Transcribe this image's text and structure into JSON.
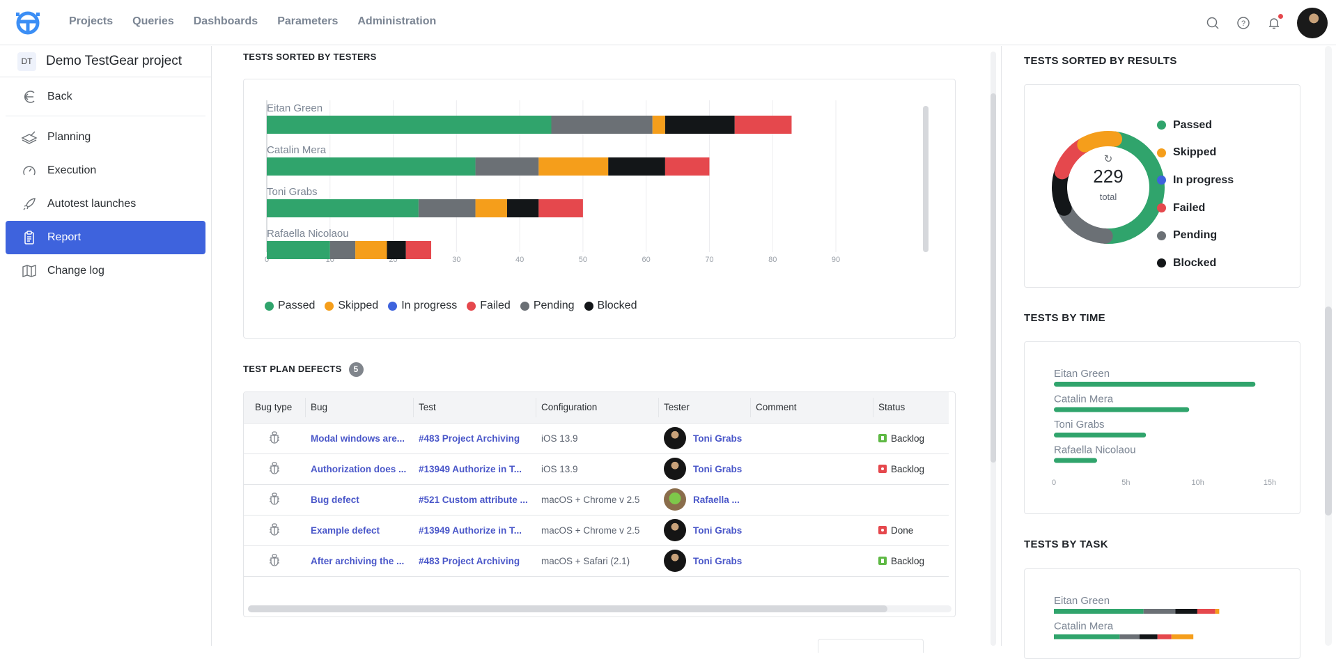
{
  "topbar": {
    "nav": [
      "Projects",
      "Queries",
      "Dashboards",
      "Parameters",
      "Administration"
    ],
    "icons": [
      "search-icon",
      "help-icon",
      "bell-icon",
      "user-avatar"
    ],
    "has_notification": true
  },
  "sidebar": {
    "project_badge": "DT",
    "project_name": "Demo TestGear project",
    "back_label": "Back",
    "items": [
      {
        "label": "Planning",
        "icon": "planning-icon"
      },
      {
        "label": "Execution",
        "icon": "speedometer-icon"
      },
      {
        "label": "Autotest launches",
        "icon": "rocket-icon"
      },
      {
        "label": "Report",
        "icon": "clipboard-icon",
        "active": true
      },
      {
        "label": "Change log",
        "icon": "map-icon"
      }
    ]
  },
  "colors": {
    "Passed": "#30a46c",
    "Skipped": "#f59e1b",
    "In progress": "#3e63dd",
    "Failed": "#e5484d",
    "Pending": "#6b7075",
    "Blocked": "#131618"
  },
  "testers_section": {
    "title": "TESTS SORTED BY TESTERS"
  },
  "defects_section": {
    "title": "TEST PLAN DEFECTS",
    "count": "5",
    "columns": [
      "Bug type",
      "Bug",
      "Test",
      "Configuration",
      "Tester",
      "Comment",
      "Status"
    ],
    "rows": [
      {
        "bug": "Modal windows are...",
        "test": "#483 Project Archiving",
        "configuration": "iOS 13.9",
        "tester": "Toni Grabs",
        "avatar": "dark",
        "comment": "",
        "status": "Backlog",
        "status_color": "green"
      },
      {
        "bug": "Authorization does ...",
        "test": "#13949 Authorize in T...",
        "configuration": "iOS 13.9",
        "tester": "Toni Grabs",
        "avatar": "dark",
        "comment": "",
        "status": "Backlog",
        "status_color": "red"
      },
      {
        "bug": "Bug defect",
        "test": "#521 Custom attribute ...",
        "configuration": "macOS + Chrome v 2.5",
        "tester": "Rafaella ...",
        "avatar": "green",
        "comment": "",
        "status": "",
        "status_color": ""
      },
      {
        "bug": "Example defect",
        "test": "#13949 Authorize in T...",
        "configuration": "macOS + Chrome v 2.5",
        "tester": "Toni Grabs",
        "avatar": "dark",
        "comment": "",
        "status": "Done",
        "status_color": "red"
      },
      {
        "bug": "After archiving the ...",
        "test": "#483 Project Archiving",
        "configuration": "macOS + Safari (2.1)",
        "tester": "Toni Grabs",
        "avatar": "dark",
        "comment": "",
        "status": "Backlog",
        "status_color": "green"
      }
    ]
  },
  "results_section": {
    "title": "TESTS SORTED BY RESULTS",
    "total": "229",
    "total_label": "total"
  },
  "time_section": {
    "title": "TESTS BY TIME"
  },
  "task_section": {
    "title": "TESTS BY TASK"
  },
  "chart_data": [
    {
      "type": "bar",
      "orientation": "horizontal-stacked",
      "title": "TESTS SORTED BY TESTERS",
      "categories": [
        "Eitan Green",
        "Catalin Mera",
        "Toni Grabs",
        "Rafaella Nicolaou"
      ],
      "series": [
        {
          "name": "Passed",
          "values": [
            45,
            33,
            24,
            10
          ]
        },
        {
          "name": "Pending",
          "values": [
            16,
            10,
            9,
            4
          ]
        },
        {
          "name": "Skipped",
          "values": [
            2,
            11,
            5,
            5
          ]
        },
        {
          "name": "Blocked",
          "values": [
            11,
            9,
            5,
            3
          ]
        },
        {
          "name": "Failed",
          "values": [
            9,
            7,
            7,
            4
          ]
        },
        {
          "name": "In progress",
          "values": [
            0,
            0,
            0,
            0
          ]
        }
      ],
      "xlim": [
        0,
        90
      ],
      "xticks": [
        0,
        10,
        20,
        30,
        40,
        50,
        60,
        70,
        80,
        90
      ],
      "legend": [
        "Passed",
        "Skipped",
        "In progress",
        "Failed",
        "Pending",
        "Blocked"
      ],
      "legend_position": "bottom",
      "grid": true
    },
    {
      "type": "pie",
      "variant": "donut",
      "title": "TESTS SORTED BY RESULTS",
      "slices": [
        {
          "name": "Passed",
          "value": 112
        },
        {
          "name": "Pending",
          "value": 39
        },
        {
          "name": "Blocked",
          "value": 28
        },
        {
          "name": "Failed",
          "value": 27
        },
        {
          "name": "Skipped",
          "value": 23
        },
        {
          "name": "In progress",
          "value": 0
        }
      ],
      "center_value": "229",
      "center_label": "total",
      "legend": [
        "Passed",
        "Skipped",
        "In progress",
        "Failed",
        "Pending",
        "Blocked"
      ],
      "legend_position": "right"
    },
    {
      "type": "bar",
      "orientation": "horizontal",
      "title": "TESTS BY TIME",
      "categories": [
        "Eitan Green",
        "Catalin Mera",
        "Toni Grabs",
        "Rafaella Nicolaou"
      ],
      "values_hours": [
        14,
        9.4,
        6.4,
        3
      ],
      "xlim": [
        0,
        15
      ],
      "xticks": [
        "0",
        "5h",
        "10h",
        "15h"
      ]
    },
    {
      "type": "bar",
      "orientation": "horizontal-stacked",
      "title": "TESTS BY TASK",
      "categories": [
        "Eitan Green",
        "Catalin Mera"
      ],
      "series": [
        {
          "name": "Passed",
          "values": [
            45,
            33
          ]
        },
        {
          "name": "Pending",
          "values": [
            16,
            10
          ]
        },
        {
          "name": "Blocked",
          "values": [
            11,
            9
          ]
        },
        {
          "name": "Failed",
          "values": [
            9,
            7
          ]
        },
        {
          "name": "Skipped",
          "values": [
            2,
            11
          ]
        }
      ]
    }
  ]
}
